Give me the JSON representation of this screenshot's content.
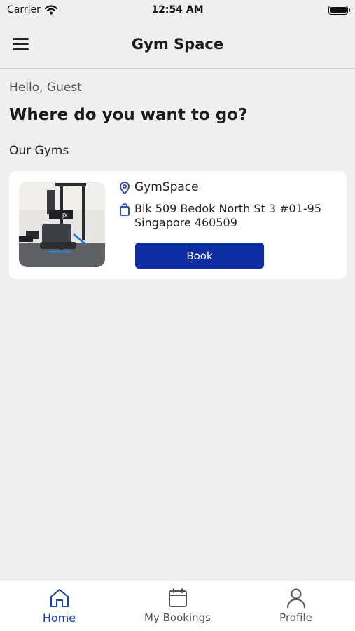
{
  "status_bar": {
    "carrier": "Carrier",
    "time": "12:54 AM"
  },
  "header": {
    "title": "Gym Space"
  },
  "main": {
    "greeting": "Hello, Guest",
    "headline": "Where do you want to go?",
    "section_title": "Our Gyms",
    "gyms": [
      {
        "name": "GymSpace",
        "address": "Blk 509 Bedok North St 3 #01-95 Singapore 460509",
        "book_label": "Book",
        "icons": {
          "location": "map-pin-icon",
          "address": "bag-icon"
        }
      }
    ]
  },
  "tabs": [
    {
      "label": "Home",
      "icon": "home-icon",
      "active": true
    },
    {
      "label": "My Bookings",
      "icon": "calendar-icon",
      "active": false
    },
    {
      "label": "Profile",
      "icon": "user-icon",
      "active": false
    }
  ],
  "colors": {
    "accent": "#0d2fa3",
    "active_tab": "#1f3ea8",
    "background": "#efefef"
  }
}
